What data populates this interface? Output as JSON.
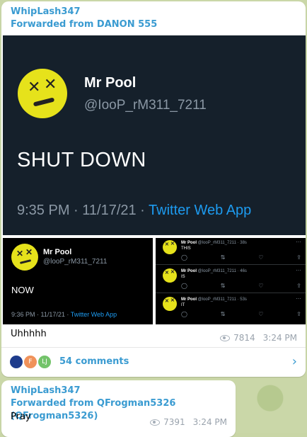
{
  "messages": [
    {
      "sender": "WhipLash347",
      "forwarded_from": "Forwarded from DANON 555",
      "tweet_main": {
        "name": "Mr Pool",
        "handle": "@IooP_rM311_7211",
        "text": "SHUT DOWN",
        "time": "9:35 PM · 11/17/21 · ",
        "app": "Twitter Web App"
      },
      "tweet_now": {
        "name": "Mr Pool",
        "handle": "@looP_rM311_7211",
        "text": "NOW",
        "time": "9:36 PM · 11/17/21 · ",
        "app": "Twitter Web App"
      },
      "thread": [
        {
          "name": "Mr Pool",
          "meta": "@looP_rM311_7211 · 38s",
          "text": "THIS"
        },
        {
          "name": "Mr Pool",
          "meta": "@looP_rM311_7211 · 46s",
          "text": "IS"
        },
        {
          "name": "Mr Pool",
          "meta": "@looP_rM311_7211 · 53s",
          "text": "IT"
        }
      ],
      "caption": "Uhhhhh",
      "views": "7814",
      "time": "3:24 PM",
      "comments": {
        "label": "54 comments",
        "avatars": [
          "",
          "F",
          "LJ"
        ]
      }
    },
    {
      "sender": "WhipLash347",
      "forwarded_from": "Forwarded from QFrogman5326 (QFrogman5326)",
      "text": "Pray",
      "views": "7391",
      "time": "3:24 PM"
    }
  ],
  "icons": {
    "views": "eye-icon",
    "chevron": "chevron-right-icon",
    "reply": "reply-icon",
    "retweet": "retweet-icon",
    "like": "heart-icon",
    "share": "share-icon",
    "more": "more-icon"
  },
  "colors": {
    "accent": "#3a9bd1",
    "tweet_bg": "#15202b",
    "avatar_yellow": "#e6e21b",
    "twitter_blue": "#1d9bf0"
  }
}
